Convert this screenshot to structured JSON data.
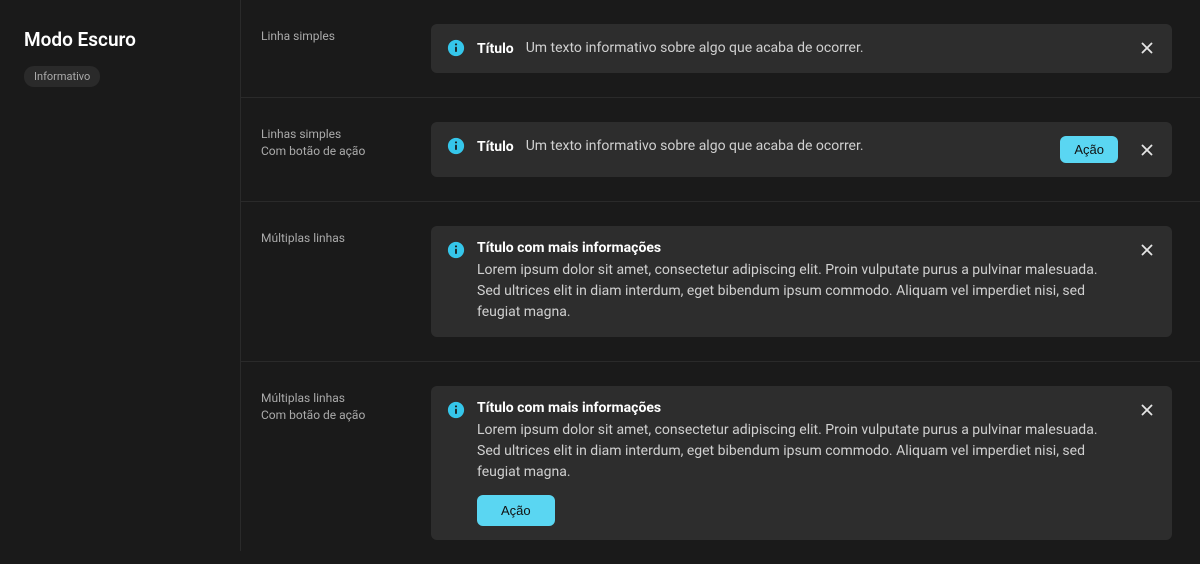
{
  "sidebar": {
    "title": "Modo Escuro",
    "badge": "Informativo"
  },
  "rows": [
    {
      "label_line1": "Linha simples",
      "label_line2": "",
      "toast_title": "Título",
      "toast_desc": "Um texto informativo sobre algo que acaba de ocorrer.",
      "action": ""
    },
    {
      "label_line1": "Linhas simples",
      "label_line2": "Com botão de ação",
      "toast_title": "Título",
      "toast_desc": "Um texto informativo sobre algo que acaba de ocorrer.",
      "action": "Ação"
    },
    {
      "label_line1": "Múltiplas linhas",
      "label_line2": "",
      "toast_title": "Título com mais informações",
      "toast_desc": "Lorem ipsum dolor sit amet, consectetur adipiscing elit. Proin vulputate purus a pulvinar malesuada. Sed ultrices elit in diam interdum, eget bibendum ipsum commodo. Aliquam vel imperdiet nisi, sed feugiat magna.",
      "action": ""
    },
    {
      "label_line1": "Múltiplas linhas",
      "label_line2": "Com botão de ação",
      "toast_title": "Título com mais informações",
      "toast_desc": "Lorem ipsum dolor sit amet, consectetur adipiscing elit. Proin vulputate purus a pulvinar malesuada. Sed ultrices elit in diam interdum, eget bibendum ipsum commodo. Aliquam vel imperdiet nisi, sed feugiat magna.",
      "action": "Ação"
    }
  ],
  "colors": {
    "accent": "#5ad6f2",
    "info_icon": "#35c6ea"
  }
}
